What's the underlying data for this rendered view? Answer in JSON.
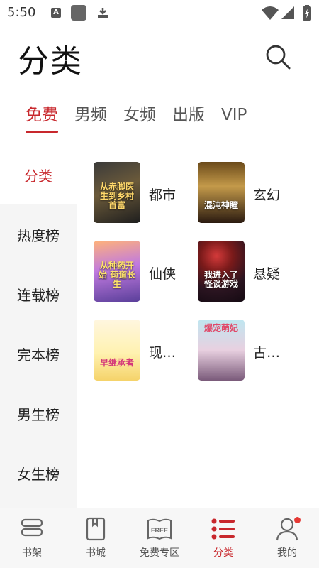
{
  "status_bar": {
    "time": "5:50",
    "a_glyph": "A"
  },
  "header": {
    "title": "分类"
  },
  "tabs": [
    {
      "label": "免费",
      "active": true
    },
    {
      "label": "男频",
      "active": false
    },
    {
      "label": "女频",
      "active": false
    },
    {
      "label": "出版",
      "active": false
    },
    {
      "label": "VIP",
      "active": false
    }
  ],
  "left_nav": [
    {
      "label": "分类",
      "active": true
    },
    {
      "label": "热度榜",
      "active": false
    },
    {
      "label": "连载榜",
      "active": false
    },
    {
      "label": "完本榜",
      "active": false
    },
    {
      "label": "男生榜",
      "active": false
    },
    {
      "label": "女生榜",
      "active": false
    }
  ],
  "categories": [
    {
      "label": "都市",
      "cover_text": "从赤脚医生到乡村首富"
    },
    {
      "label": "玄幻",
      "cover_text": "混沌神瞳"
    },
    {
      "label": "仙侠",
      "cover_text": "从种药开始 苟道长生"
    },
    {
      "label": "悬疑",
      "cover_text": "我进入了怪谈游戏"
    },
    {
      "label": "现…",
      "cover_text": "早继承者"
    },
    {
      "label": "古…",
      "cover_text": "爆宠萌妃"
    }
  ],
  "bottom_nav": [
    {
      "label": "书架",
      "icon": "bookshelf-icon",
      "active": false
    },
    {
      "label": "书城",
      "icon": "bookstore-icon",
      "active": false
    },
    {
      "label": "免费专区",
      "icon": "free-book-icon",
      "active": false,
      "icon_text": "FREE"
    },
    {
      "label": "分类",
      "icon": "category-list-icon",
      "active": true
    },
    {
      "label": "我的",
      "icon": "profile-icon",
      "active": false,
      "has_badge": true
    }
  ],
  "colors": {
    "accent": "#c8282d",
    "badge": "#e53935",
    "nav_bg": "#f5f5f5"
  }
}
